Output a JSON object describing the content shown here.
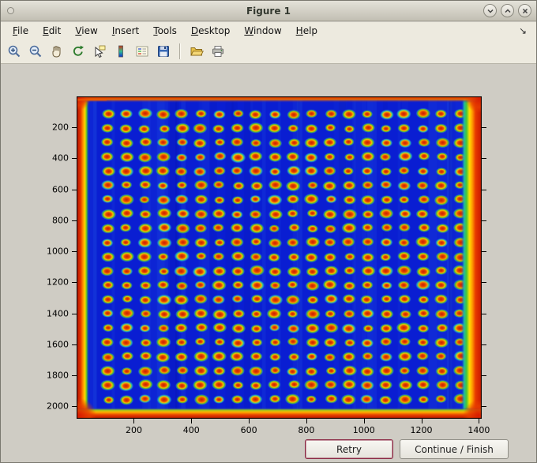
{
  "window": {
    "title": "Figure 1",
    "controls": {
      "left_icon": "window-menu-icon",
      "right_icons": [
        "shade-icon",
        "maximize-icon",
        "close-icon"
      ]
    }
  },
  "menubar": {
    "items": [
      "File",
      "Edit",
      "View",
      "Insert",
      "Tools",
      "Desktop",
      "Window",
      "Help"
    ],
    "dock_arrow": "↘"
  },
  "toolbar": {
    "icons": [
      "zoom-in",
      "zoom-out",
      "pan-hand",
      "rotate-3d",
      "data-cursor",
      "insert-colorbar",
      "insert-legend",
      "save-figure",
      "open-file",
      "print-figure"
    ]
  },
  "plot": {
    "x_ticks": [
      200,
      400,
      600,
      800,
      1000,
      1200,
      1400
    ],
    "y_ticks": [
      200,
      400,
      600,
      800,
      1000,
      1200,
      1400,
      1600,
      1800,
      2000
    ],
    "x_range": [
      1,
      1410
    ],
    "y_range": [
      1,
      2080
    ],
    "colors": {
      "background": "#0a1ed2",
      "spot_core": "#c81c00",
      "spot_ring": "#ffc800",
      "spot_halo_green": "#4cc428",
      "spot_halo_cyan": "#22c8a0",
      "edge_red": "#c81600",
      "edge_yellow": "#ffd800"
    },
    "spot_grid": {
      "rows": 21,
      "cols": 20,
      "x_start": 110,
      "x_step": 64.5,
      "y_start": 115,
      "y_step": 92
    }
  },
  "buttons": {
    "retry": "Retry",
    "continue_finish": "Continue / Finish"
  }
}
